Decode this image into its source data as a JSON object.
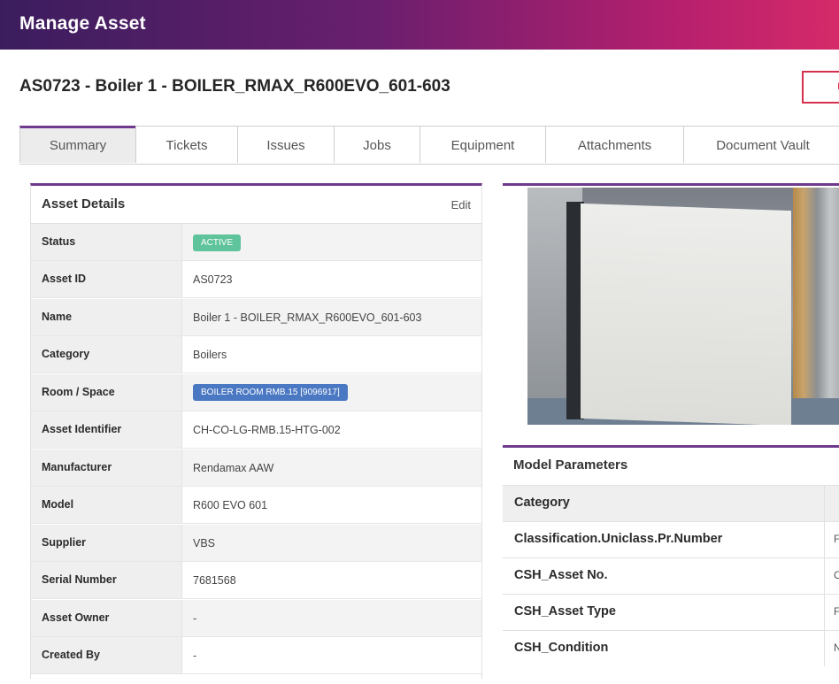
{
  "header": {
    "title": "Manage Asset"
  },
  "asset_title": "AS0723 - Boiler 1 - BOILER_RMAX_R600EVO_601-603",
  "top_button": {
    "label": "I"
  },
  "tabs": [
    "Summary",
    "Tickets",
    "Issues",
    "Jobs",
    "Equipment",
    "Attachments",
    "Document Vault"
  ],
  "active_tab": "Summary",
  "asset_details": {
    "title": "Asset Details",
    "edit_label": "Edit",
    "rows": [
      {
        "label": "Status",
        "value": "ACTIVE"
      },
      {
        "label": "Asset ID",
        "value": "AS0723"
      },
      {
        "label": "Name",
        "value": "Boiler 1 - BOILER_RMAX_R600EVO_601-603"
      },
      {
        "label": "Category",
        "value": "Boilers"
      },
      {
        "label": "Room / Space",
        "value": "BOILER ROOM RMB.15 [9096917]"
      },
      {
        "label": "Asset Identifier",
        "value": "CH-CO-LG-RMB.15-HTG-002"
      },
      {
        "label": "Manufacturer",
        "value": "Rendamax AAW"
      },
      {
        "label": "Model",
        "value": "R600 EVO 601"
      },
      {
        "label": "Supplier",
        "value": "VBS"
      },
      {
        "label": "Serial Number",
        "value": "7681568"
      },
      {
        "label": "Asset Owner",
        "value": "-"
      },
      {
        "label": "Created By",
        "value": "-"
      }
    ]
  },
  "model_parameters": {
    "title": "Model Parameters",
    "rows": [
      {
        "key": "Category",
        "value": ""
      },
      {
        "key": "Classification.Uniclass.Pr.Number",
        "value": "F"
      },
      {
        "key": "CSH_Asset No.",
        "value": "C"
      },
      {
        "key": "CSH_Asset Type",
        "value": "F"
      },
      {
        "key": "CSH_Condition",
        "value": "N"
      }
    ]
  },
  "colors": {
    "accent": "#6f3a8d",
    "active_badge": "#5fc39b",
    "room_badge": "#4a78c2",
    "button_border": "#d8314f"
  }
}
